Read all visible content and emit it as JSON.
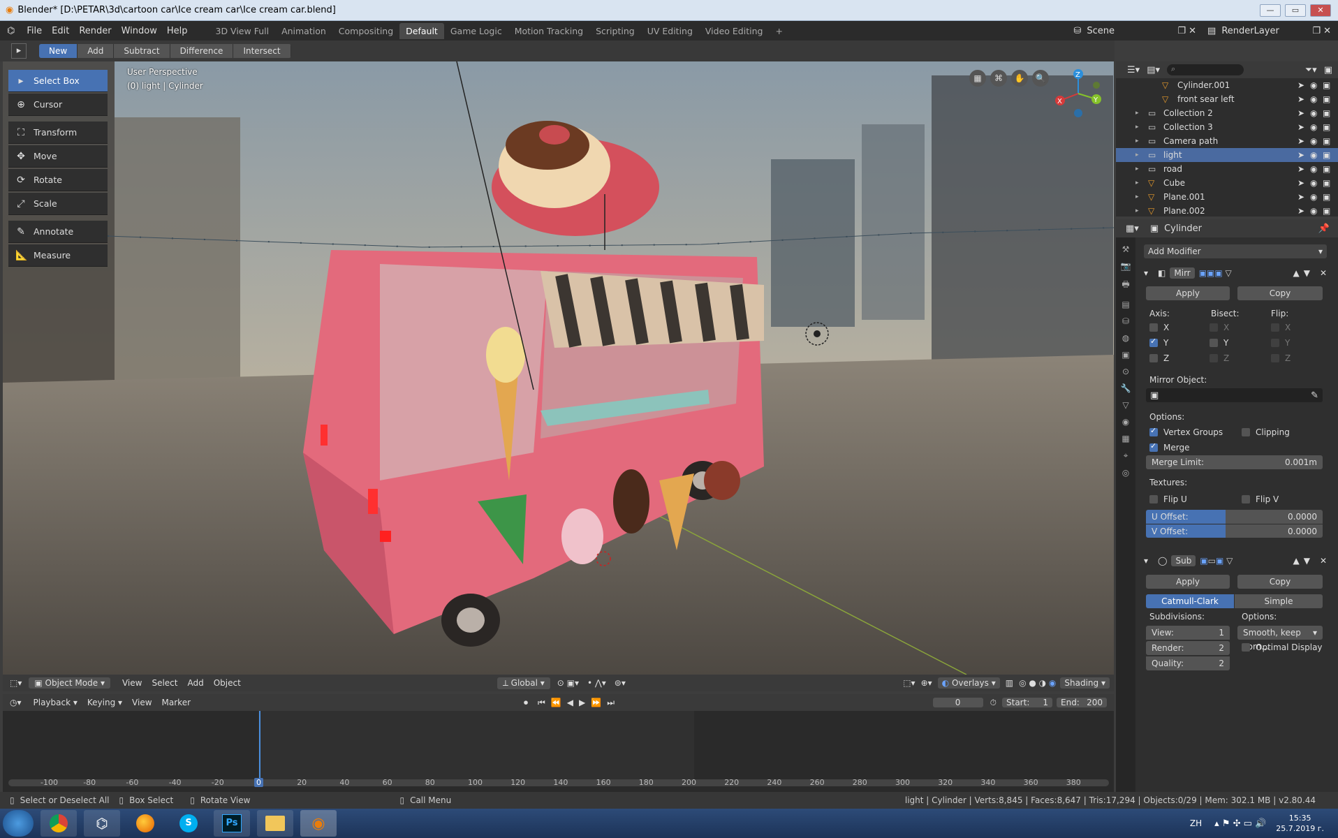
{
  "window": {
    "title": "Blender* [D:\\PETAR\\3d\\cartoon car\\Ice cream car\\Ice cream car.blend]"
  },
  "menu": [
    "File",
    "Edit",
    "Render",
    "Window",
    "Help"
  ],
  "workspaces": [
    "3D View Full",
    "Animation",
    "Compositing",
    "Default",
    "Game Logic",
    "Motion Tracking",
    "Scripting",
    "UV Editing",
    "Video Editing"
  ],
  "active_workspace": "Default",
  "scene": "Scene",
  "render_layer": "RenderLayer",
  "select_modes": [
    "New",
    "Add",
    "Subtract",
    "Difference",
    "Intersect"
  ],
  "tools": [
    "Select Box",
    "Cursor",
    "Transform",
    "Move",
    "Rotate",
    "Scale",
    "Annotate",
    "Measure"
  ],
  "viewport": {
    "perspective": "User Perspective",
    "object_info": "(0) light | Cylinder"
  },
  "viewport_header": {
    "mode": "Object Mode",
    "menus": [
      "View",
      "Select",
      "Add",
      "Object"
    ],
    "orientation": "Global",
    "overlays": "Overlays",
    "shading": "Shading"
  },
  "gizmo": {
    "x": "X",
    "y": "Y",
    "z": "Z"
  },
  "outliner": [
    {
      "name": "Cylinder.001"
    },
    {
      "name": "front sear left"
    },
    {
      "name": "Collection 2"
    },
    {
      "name": "Collection 3"
    },
    {
      "name": "Camera path"
    },
    {
      "name": "light",
      "selected": true
    },
    {
      "name": "road"
    },
    {
      "name": "Cube"
    },
    {
      "name": "Plane.001"
    },
    {
      "name": "Plane.002"
    }
  ],
  "properties": {
    "object": "Cylinder",
    "add_modifier": "Add Modifier",
    "mirror": {
      "name": "Mirr",
      "apply": "Apply",
      "copy": "Copy",
      "axis_label": "Axis:",
      "bisect_label": "Bisect:",
      "flip_label": "Flip:",
      "x": "X",
      "y": "Y",
      "z": "Z",
      "mirror_object": "Mirror Object:",
      "options": "Options:",
      "vertex_groups": "Vertex Groups",
      "clipping": "Clipping",
      "merge": "Merge",
      "merge_limit_label": "Merge Limit:",
      "merge_limit": "0.001m",
      "textures": "Textures:",
      "flip_u": "Flip U",
      "flip_v": "Flip V",
      "u_offset_label": "U Offset:",
      "u_offset": "0.0000",
      "v_offset_label": "V Offset:",
      "v_offset": "0.0000"
    },
    "subsurf": {
      "name": "Sub",
      "apply": "Apply",
      "copy": "Copy",
      "catmull": "Catmull-Clark",
      "simple": "Simple",
      "subdivisions": "Subdivisions:",
      "options": "Options:",
      "view_label": "View:",
      "view": "1",
      "render_label": "Render:",
      "render": "2",
      "quality_label": "Quality:",
      "quality": "2",
      "uv_smooth": "Smooth, keep corn...",
      "optimal_display": "Optimal Display"
    }
  },
  "timeline": {
    "menus": [
      "Playback",
      "Keying",
      "View",
      "Marker"
    ],
    "current_frame": "0",
    "start_label": "Start:",
    "start": "1",
    "end_label": "End:",
    "end": "200",
    "ticks": [
      "-100",
      "-80",
      "-60",
      "-40",
      "-20",
      "0",
      "20",
      "40",
      "60",
      "80",
      "100",
      "120",
      "140",
      "160",
      "180",
      "200",
      "220",
      "240",
      "260",
      "280",
      "300",
      "320",
      "340",
      "360",
      "380"
    ]
  },
  "status": {
    "hint1": "Select or Deselect All",
    "hint2": "Box Select",
    "hint3": "Rotate View",
    "hint4": "Call Menu",
    "stats": "light | Cylinder | Verts:8,845 | Faces:8,647 | Tris:17,294 | Objects:0/29 | Mem: 302.1 MB | v2.80.44"
  },
  "taskbar": {
    "lang": "ZH",
    "time": "15:35",
    "date": "25.7.2019 г.",
    "apps": [
      "start",
      "chrome",
      "app2",
      "firefox",
      "skype",
      "ps",
      "folder",
      "blender"
    ],
    "ps_label": "Ps"
  }
}
